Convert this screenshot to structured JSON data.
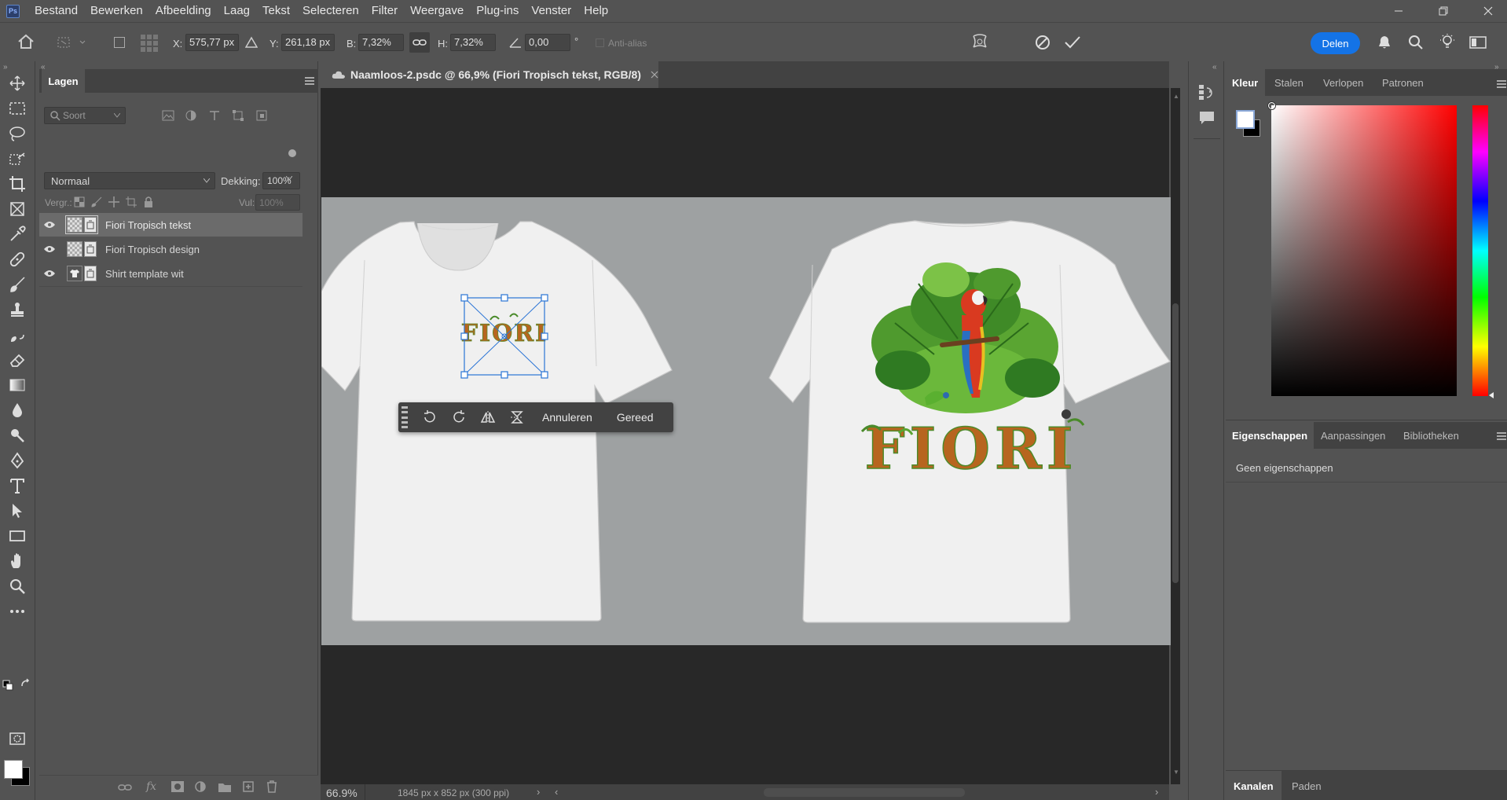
{
  "menu": [
    "Bestand",
    "Bewerken",
    "Afbeelding",
    "Laag",
    "Tekst",
    "Selecteren",
    "Filter",
    "Weergave",
    "Plug-ins",
    "Venster",
    "Help"
  ],
  "app_logo": "Ps",
  "options": {
    "x_label": "X:",
    "x_value": "575,77 px",
    "y_label": "Y:",
    "y_value": "261,18 px",
    "w_label": "B:",
    "w_value": "7,32%",
    "h_label": "H:",
    "h_value": "7,32%",
    "angle_value": "0,00",
    "angle_unit": "°",
    "antialias": "Anti-alias",
    "share": "Delen"
  },
  "layers_panel": {
    "tab": "Lagen",
    "filter_placeholder": "Soort",
    "blend_mode": "Normaal",
    "opacity_label": "Dekking:",
    "opacity_value": "100%",
    "lock_label": "Vergr.:",
    "fill_label": "Vul:",
    "fill_value": "100%",
    "layers": [
      {
        "name": "Fiori Tropisch tekst",
        "selected": true
      },
      {
        "name": "Fiori Tropisch design",
        "selected": false
      },
      {
        "name": "Shirt template wit",
        "selected": false
      }
    ]
  },
  "document": {
    "tab_title": "Naamloos-2.psdc @ 66,9% (Fiori Tropisch tekst, RGB/8)",
    "zoom": "66.9%",
    "doc_info": "1845 px x 852 px (300 ppi)"
  },
  "canvas_artwork": {
    "front_text": "FIORI",
    "back_text": "FIORI"
  },
  "transform_toolbar": {
    "cancel": "Annuleren",
    "done": "Gereed"
  },
  "color_panel": {
    "tabs": [
      "Kleur",
      "Stalen",
      "Verlopen",
      "Patronen"
    ],
    "hue_color": "#ff0000"
  },
  "properties_panel": {
    "tabs": [
      "Eigenschappen",
      "Aanpassingen",
      "Bibliotheken"
    ],
    "empty_text": "Geen eigenschappen"
  },
  "channels_panel": {
    "tabs": [
      "Kanalen",
      "Paden"
    ]
  }
}
